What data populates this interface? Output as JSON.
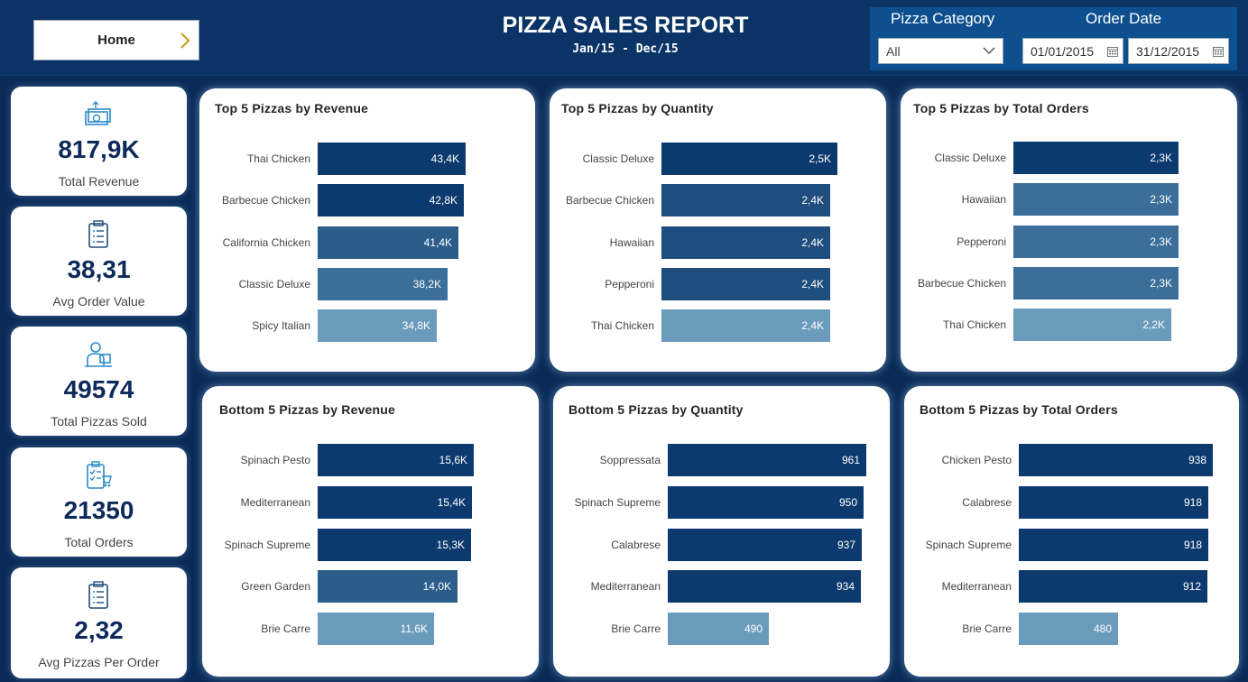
{
  "header": {
    "home_label": "Home",
    "title": "PIZZA SALES REPORT",
    "subtitle": "Jan/15 - Dec/15"
  },
  "filters": {
    "category_label": "Pizza Category",
    "category_value": "All",
    "date_label": "Order Date",
    "date_from": "01/01/2015",
    "date_to": "31/12/2015"
  },
  "kpis": [
    {
      "value": "817,9K",
      "caption": "Total Revenue",
      "icon": "money-icon"
    },
    {
      "value": "38,31",
      "caption": "Avg Order Value",
      "icon": "clipboard-icon"
    },
    {
      "value": "49574",
      "caption": "Total Pizzas Sold",
      "icon": "delivery-icon"
    },
    {
      "value": "21350",
      "caption": "Total Orders",
      "icon": "checklist-icon"
    },
    {
      "value": "2,32",
      "caption": "Avg Pizzas Per Order",
      "icon": "clipboard-icon"
    }
  ],
  "colors": {
    "background": "#0a2b57",
    "bar_dark": "#0d3a6e",
    "bar_mid": "#2b5c8a",
    "bar_light": "#6a9bbd"
  },
  "chart_data": [
    {
      "type": "bar",
      "orientation": "horizontal",
      "title": "Top 5 Pizzas by Revenue",
      "categories": [
        "Thai Chicken",
        "Barbecue Chicken",
        "California Chicken",
        "Classic Deluxe",
        "Spicy Italian"
      ],
      "values": [
        43.4,
        42.8,
        41.4,
        38.2,
        34.8
      ],
      "value_labels": [
        "43,4K",
        "42,8K",
        "41,4K",
        "38,2K",
        "34,8K"
      ]
    },
    {
      "type": "bar",
      "orientation": "horizontal",
      "title": "Top 5 Pizzas by Quantity",
      "categories": [
        "Classic Deluxe",
        "Barbecue Chicken",
        "Hawaiian",
        "Pepperoni",
        "Thai Chicken"
      ],
      "values": [
        2.5,
        2.4,
        2.4,
        2.4,
        2.4
      ],
      "value_labels": [
        "2,5K",
        "2,4K",
        "2,4K",
        "2,4K",
        "2,4K"
      ]
    },
    {
      "type": "bar",
      "orientation": "horizontal",
      "title": "Top 5 Pizzas by Total Orders",
      "categories": [
        "Classic Deluxe",
        "Hawaiian",
        "Pepperoni",
        "Barbecue Chicken",
        "Thai Chicken"
      ],
      "values": [
        2.3,
        2.3,
        2.3,
        2.3,
        2.2
      ],
      "value_labels": [
        "2,3K",
        "2,3K",
        "2,3K",
        "2,3K",
        "2,2K"
      ]
    },
    {
      "type": "bar",
      "orientation": "horizontal",
      "title": "Bottom 5 Pizzas by Revenue",
      "categories": [
        "Spinach Pesto",
        "Mediterranean",
        "Spinach Supreme",
        "Green Garden",
        "Brie Carre"
      ],
      "values": [
        15.6,
        15.4,
        15.3,
        14.0,
        11.6
      ],
      "value_labels": [
        "15,6K",
        "15,4K",
        "15,3K",
        "14,0K",
        "11,6K"
      ]
    },
    {
      "type": "bar",
      "orientation": "horizontal",
      "title": "Bottom 5 Pizzas by Quantity",
      "categories": [
        "Soppressata",
        "Spinach Supreme",
        "Calabrese",
        "Mediterranean",
        "Brie Carre"
      ],
      "values": [
        961,
        950,
        937,
        934,
        490
      ],
      "value_labels": [
        "961",
        "950",
        "937",
        "934",
        "490"
      ]
    },
    {
      "type": "bar",
      "orientation": "horizontal",
      "title": "Bottom 5 Pizzas by Total Orders",
      "categories": [
        "Chicken Pesto",
        "Calabrese",
        "Spinach Supreme",
        "Mediterranean",
        "Brie Carre"
      ],
      "values": [
        938,
        918,
        918,
        912,
        480
      ],
      "value_labels": [
        "938",
        "918",
        "918",
        "912",
        "480"
      ]
    }
  ]
}
